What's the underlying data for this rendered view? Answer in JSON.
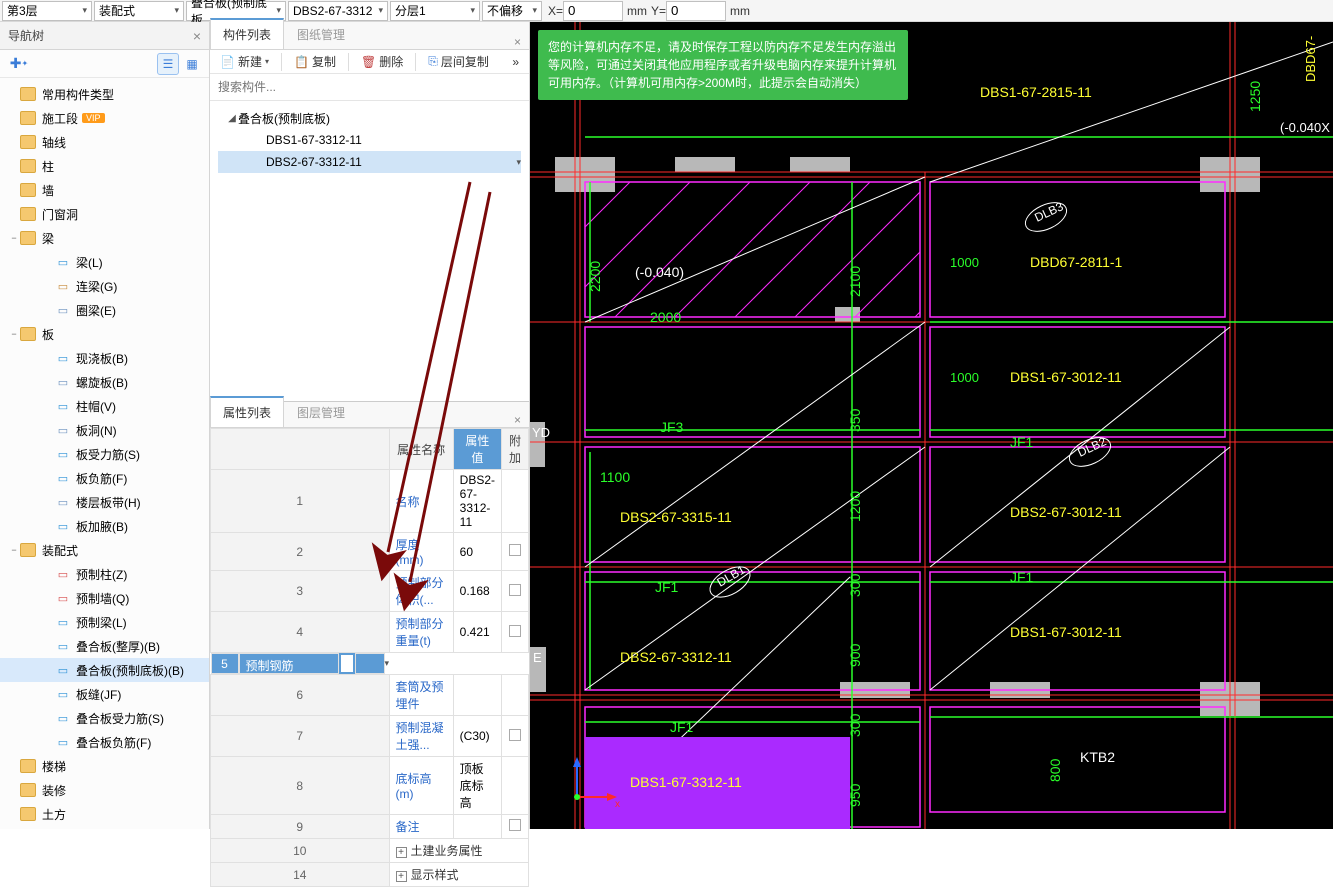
{
  "topbar": {
    "floor": "第3层",
    "style": "装配式",
    "comp_type": "叠合板(预制底板",
    "comp_name": "DBS2-67-3312",
    "layer": "分层1",
    "offset": "不偏移",
    "x_label": "X=",
    "x_val": "0",
    "x_unit": "mm",
    "y_label": "Y=",
    "y_val": "0",
    "y_unit": "mm"
  },
  "left": {
    "title": "导航树",
    "items": [
      {
        "l": 1,
        "exp": "",
        "ic": "folder",
        "label": "常用构件类型"
      },
      {
        "l": 1,
        "exp": "",
        "ic": "folder",
        "label": "施工段",
        "vip": true
      },
      {
        "l": 1,
        "exp": "",
        "ic": "folder",
        "label": "轴线"
      },
      {
        "l": 1,
        "exp": "",
        "ic": "folder",
        "label": "柱"
      },
      {
        "l": 1,
        "exp": "",
        "ic": "folder",
        "label": "墙"
      },
      {
        "l": 1,
        "exp": "",
        "ic": "folder",
        "label": "门窗洞"
      },
      {
        "l": 1,
        "exp": "−",
        "ic": "folder",
        "label": "梁"
      },
      {
        "l": 2,
        "ic": "beam",
        "color": "#2a90d6",
        "label": "梁(L)"
      },
      {
        "l": 2,
        "ic": "beam2",
        "color": "#c68a3a",
        "label": "连梁(G)"
      },
      {
        "l": 2,
        "ic": "ring",
        "color": "#6a8fbd",
        "label": "圈梁(E)"
      },
      {
        "l": 1,
        "exp": "−",
        "ic": "folder",
        "label": "板"
      },
      {
        "l": 2,
        "ic": "slab",
        "color": "#2a90d6",
        "label": "现浇板(B)"
      },
      {
        "l": 2,
        "ic": "spiral",
        "color": "#6a8fbd",
        "label": "螺旋板(B)"
      },
      {
        "l": 2,
        "ic": "cap",
        "color": "#2a90d6",
        "label": "柱帽(V)"
      },
      {
        "l": 2,
        "ic": "hole",
        "color": "#6a8fbd",
        "label": "板洞(N)"
      },
      {
        "l": 2,
        "ic": "rebar",
        "color": "#2a90d6",
        "label": "板受力筋(S)"
      },
      {
        "l": 2,
        "ic": "rebar2",
        "color": "#2a90d6",
        "label": "板负筋(F)"
      },
      {
        "l": 2,
        "ic": "band",
        "color": "#6a8fbd",
        "label": "楼层板带(H)"
      },
      {
        "l": 2,
        "ic": "thick",
        "color": "#2a90d6",
        "label": "板加腋(B)"
      },
      {
        "l": 1,
        "exp": "−",
        "ic": "folder",
        "label": "装配式"
      },
      {
        "l": 2,
        "ic": "pcol",
        "color": "#d64a4a",
        "label": "预制柱(Z)"
      },
      {
        "l": 2,
        "ic": "pwall",
        "color": "#d64a4a",
        "label": "预制墙(Q)"
      },
      {
        "l": 2,
        "ic": "pbeam",
        "color": "#2a90d6",
        "label": "预制梁(L)"
      },
      {
        "l": 2,
        "ic": "comp1",
        "color": "#2a90d6",
        "label": "叠合板(整厚)(B)"
      },
      {
        "l": 2,
        "ic": "comp2",
        "color": "#2a90d6",
        "label": "叠合板(预制底板)(B)",
        "sel": true
      },
      {
        "l": 2,
        "ic": "seam",
        "color": "#2a90d6",
        "label": "板缝(JF)"
      },
      {
        "l": 2,
        "ic": "crebar",
        "color": "#2a90d6",
        "label": "叠合板受力筋(S)"
      },
      {
        "l": 2,
        "ic": "crebar2",
        "color": "#2a90d6",
        "label": "叠合板负筋(F)"
      },
      {
        "l": 1,
        "exp": "",
        "ic": "folder",
        "label": "楼梯"
      },
      {
        "l": 1,
        "exp": "",
        "ic": "folder",
        "label": "装修"
      },
      {
        "l": 1,
        "exp": "",
        "ic": "folder",
        "label": "土方"
      }
    ]
  },
  "mid": {
    "tabs": [
      "构件列表",
      "图纸管理"
    ],
    "tb": {
      "new": "新建",
      "copy": "复制",
      "del": "删除",
      "layercopy": "层间复制"
    },
    "search_ph": "搜索构件...",
    "tree": [
      {
        "l": 0,
        "exp": "◢",
        "label": "叠合板(预制底板)"
      },
      {
        "l": 1,
        "label": "DBS1-67-3312-11"
      },
      {
        "l": 1,
        "label": "DBS2-67-3312-11",
        "sel": true
      }
    ],
    "prop_tabs": [
      "属性列表",
      "图层管理"
    ],
    "prop_headers": {
      "name": "属性名称",
      "val": "属性值",
      "extra": "附加"
    },
    "props": [
      {
        "n": "1",
        "name": "名称",
        "val": "DBS2-67-3312-11"
      },
      {
        "n": "2",
        "name": "厚度(mm)",
        "val": "60",
        "chk": true
      },
      {
        "n": "3",
        "name": "预制部分体积(...",
        "val": "0.168",
        "chk": true
      },
      {
        "n": "4",
        "name": "预制部分重量(t)",
        "val": "0.421",
        "chk": true
      },
      {
        "n": "5",
        "name": "预制钢筋",
        "val": "",
        "sel": true
      },
      {
        "n": "6",
        "name": "套筒及预埋件",
        "val": ""
      },
      {
        "n": "7",
        "name": "预制混凝土强...",
        "val": "(C30)",
        "chk": true
      },
      {
        "n": "8",
        "name": "底标高(m)",
        "val": "顶板底标高"
      },
      {
        "n": "9",
        "name": "备注",
        "val": "",
        "chk": true
      },
      {
        "n": "10",
        "name": "土建业务属性",
        "exp": "+",
        "group": true
      },
      {
        "n": "14",
        "name": "显示样式",
        "exp": "+",
        "group": true
      }
    ]
  },
  "msg": "您的计算机内存不足，请及时保存工程以防内存不足发生内存溢出等风险，可通过关闭其他应用程序或者升级电脑内存来提升计算机可用内存。（计算机可用内存>200M时，此提示会自动消失）",
  "cad_labels": {
    "a": "DBS1-67-2815-11",
    "b": "DBD67-2811-1",
    "c": "DBS1-67-3012-11",
    "d": "DBS2-67-3012-11",
    "e": "DBS1-67-3012-11",
    "f": "DBS2-67-3315-11",
    "g": "DBS2-67-3312-11",
    "h": "DBS1-67-3312-11",
    "i": "KTB2",
    "jf": "JF1",
    "jf3": "JF3",
    "dlb1": "DLB1",
    "dlb2": "DLB2",
    "dlb3": "DLB3",
    "d2200": "2200",
    "d2000": "2000",
    "d1100": "1100",
    "d1000": "1000",
    "d350": "350",
    "d300": "300",
    "d1200": "1200",
    "d900": "900",
    "d800": "800",
    "d950": "950",
    "d1250": "1250",
    "d2100": "2100",
    "neg": "(-0.040)",
    "neg2": "(-0.040X",
    "yd": "YD",
    "E": "E",
    "dbd67": "DBD67-"
  }
}
